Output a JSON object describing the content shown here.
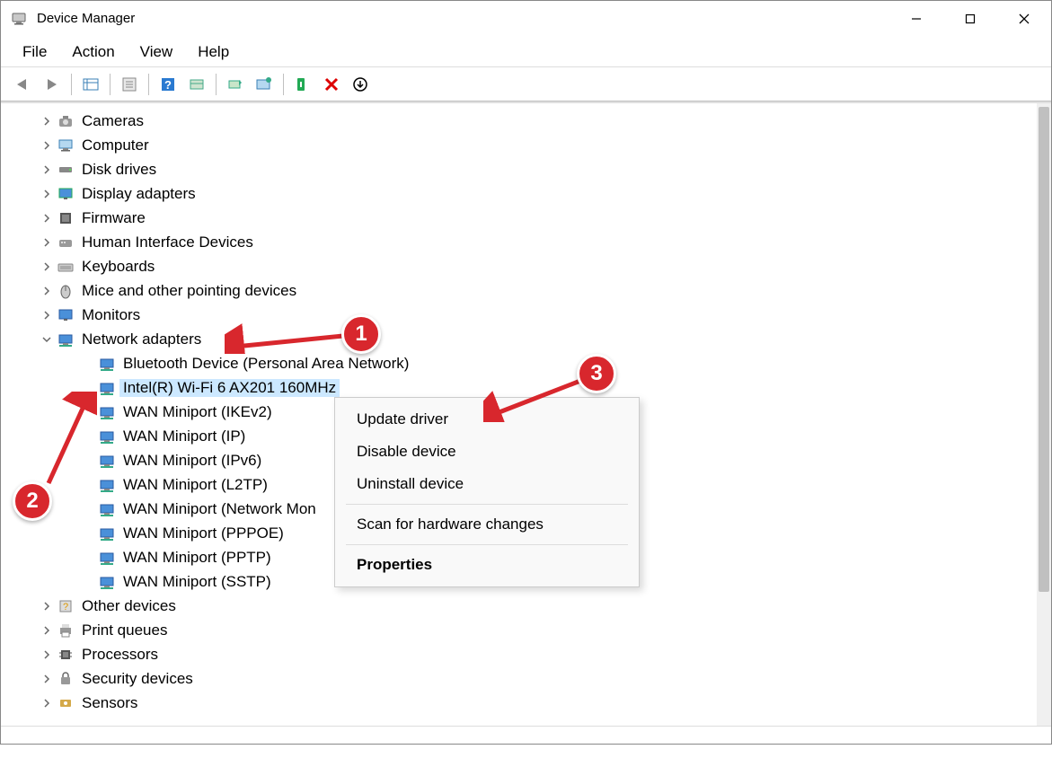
{
  "window": {
    "title": "Device Manager"
  },
  "menu": {
    "file": "File",
    "action": "Action",
    "view": "View",
    "help": "Help"
  },
  "tree": {
    "categories": [
      {
        "label": "Cameras",
        "expanded": false,
        "icon": "camera"
      },
      {
        "label": "Computer",
        "expanded": false,
        "icon": "computer"
      },
      {
        "label": "Disk drives",
        "expanded": false,
        "icon": "disk"
      },
      {
        "label": "Display adapters",
        "expanded": false,
        "icon": "display"
      },
      {
        "label": "Firmware",
        "expanded": false,
        "icon": "firmware"
      },
      {
        "label": "Human Interface Devices",
        "expanded": false,
        "icon": "hid"
      },
      {
        "label": "Keyboards",
        "expanded": false,
        "icon": "keyboard"
      },
      {
        "label": "Mice and other pointing devices",
        "expanded": false,
        "icon": "mouse"
      },
      {
        "label": "Monitors",
        "expanded": false,
        "icon": "monitor"
      },
      {
        "label": "Network adapters",
        "expanded": true,
        "icon": "network",
        "children": [
          {
            "label": "Bluetooth Device (Personal Area Network)"
          },
          {
            "label": "Intel(R) Wi-Fi 6 AX201 160MHz",
            "selected": true
          },
          {
            "label": "WAN Miniport (IKEv2)"
          },
          {
            "label": "WAN Miniport (IP)"
          },
          {
            "label": "WAN Miniport (IPv6)"
          },
          {
            "label": "WAN Miniport (L2TP)"
          },
          {
            "label": "WAN Miniport (Network Mon"
          },
          {
            "label": "WAN Miniport (PPPOE)"
          },
          {
            "label": "WAN Miniport (PPTP)"
          },
          {
            "label": "WAN Miniport (SSTP)"
          }
        ]
      },
      {
        "label": "Other devices",
        "expanded": false,
        "icon": "other"
      },
      {
        "label": "Print queues",
        "expanded": false,
        "icon": "printer"
      },
      {
        "label": "Processors",
        "expanded": false,
        "icon": "cpu"
      },
      {
        "label": "Security devices",
        "expanded": false,
        "icon": "security"
      },
      {
        "label": "Sensors",
        "expanded": false,
        "icon": "sensor"
      }
    ]
  },
  "context_menu": {
    "update": "Update driver",
    "disable": "Disable device",
    "uninstall": "Uninstall device",
    "scan": "Scan for hardware changes",
    "properties": "Properties"
  },
  "annotations": {
    "b1": "1",
    "b2": "2",
    "b3": "3"
  }
}
